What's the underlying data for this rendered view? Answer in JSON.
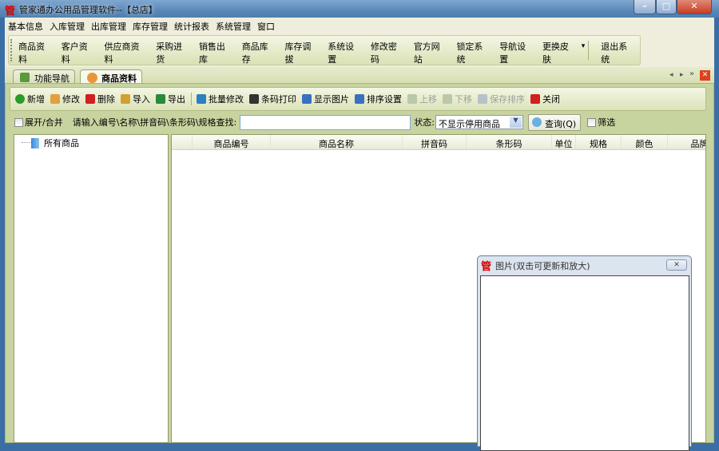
{
  "window": {
    "title": "管家通办公用品管理软件--【总店】",
    "logo_char": "管",
    "minimize": "–",
    "maximize": "□",
    "close": "✕"
  },
  "menu": [
    "基本信息",
    "入库管理",
    "出库管理",
    "库存管理",
    "统计报表",
    "系统管理",
    "窗口"
  ],
  "toolbar": [
    {
      "label": "商品资料",
      "icon": "goods-icon",
      "color": "#e8963a"
    },
    {
      "label": "客户资料",
      "icon": "customers-icon",
      "color": "#4a9a4a"
    },
    {
      "label": "供应商资料",
      "icon": "suppliers-icon",
      "color": "#c77a3a"
    },
    {
      "label": "采购进货",
      "icon": "truck-icon",
      "color": "#d9823a"
    },
    {
      "label": "销售出库",
      "icon": "basket-icon",
      "color": "#d42020"
    },
    {
      "label": "商品库存",
      "icon": "box-icon",
      "color": "#e0b040"
    },
    {
      "label": "库存调拔",
      "icon": "transfer-icon",
      "color": "#c03030"
    },
    {
      "label": "系统设置",
      "icon": "settings-icon",
      "color": "#4a70b0"
    },
    {
      "label": "修改密码",
      "icon": "key-icon",
      "color": "#d8b040"
    },
    {
      "label": "官方网站",
      "icon": "ie-icon",
      "color": "#2a7ad0"
    },
    {
      "label": "锁定系统",
      "icon": "lock-icon",
      "color": "#4a8ad0"
    },
    {
      "label": "导航设置",
      "icon": "nav-icon",
      "color": "#b05050"
    },
    {
      "label": "更换皮肤",
      "icon": "skin-icon",
      "color": "#a040c0"
    },
    {
      "label": "退出系统",
      "icon": "exit-icon",
      "color": "#8a5a2a"
    }
  ],
  "tabs": [
    {
      "label": "功能导航",
      "active": false
    },
    {
      "label": "商品资料",
      "active": true
    }
  ],
  "actions": [
    {
      "label": "新增",
      "icon": "add-icon",
      "color": "#2a9a2a",
      "enabled": true
    },
    {
      "label": "修改",
      "icon": "edit-icon",
      "color": "#e0a040",
      "enabled": true
    },
    {
      "label": "删除",
      "icon": "delete-icon",
      "color": "#d02020",
      "enabled": true
    },
    {
      "label": "导入",
      "icon": "import-icon",
      "color": "#d0a030",
      "enabled": true
    },
    {
      "label": "导出",
      "icon": "excel-icon",
      "color": "#2a8a3a",
      "enabled": true
    },
    {
      "label": "批量修改",
      "icon": "recycle-icon",
      "color": "#2a80c0",
      "enabled": true
    },
    {
      "label": "条码打印",
      "icon": "barcode-icon",
      "color": "#333333",
      "enabled": true
    },
    {
      "label": "显示图片",
      "icon": "picture-icon",
      "color": "#3a70c0",
      "enabled": true
    },
    {
      "label": "排序设置",
      "icon": "sort-icon",
      "color": "#3a70c0",
      "enabled": true
    },
    {
      "label": "上移",
      "icon": "move-up-icon",
      "color": "#b8c8a8",
      "enabled": false
    },
    {
      "label": "下移",
      "icon": "move-down-icon",
      "color": "#b8c8a8",
      "enabled": false
    },
    {
      "label": "保存排序",
      "icon": "save-icon",
      "color": "#b8c0c8",
      "enabled": false
    },
    {
      "label": "关闭",
      "icon": "close-icon",
      "color": "#d02020",
      "enabled": true
    }
  ],
  "search": {
    "expand_label": "展开/合并",
    "prompt": "请输入编号\\名称\\拼音码\\条形码\\规格查找:",
    "value": "",
    "status_label": "状态:",
    "status_value": "不显示停用商品",
    "query_button": "查询(Q)",
    "filter_label": "筛选"
  },
  "tree": {
    "root": "所有商品"
  },
  "grid": {
    "columns": [
      "",
      "商品编号",
      "商品名称",
      "拼音码",
      "条形码",
      "单位",
      "规格",
      "颜色",
      "品牌"
    ]
  },
  "popup": {
    "title": "图片(双击可更新和放大)",
    "close": "✕"
  }
}
